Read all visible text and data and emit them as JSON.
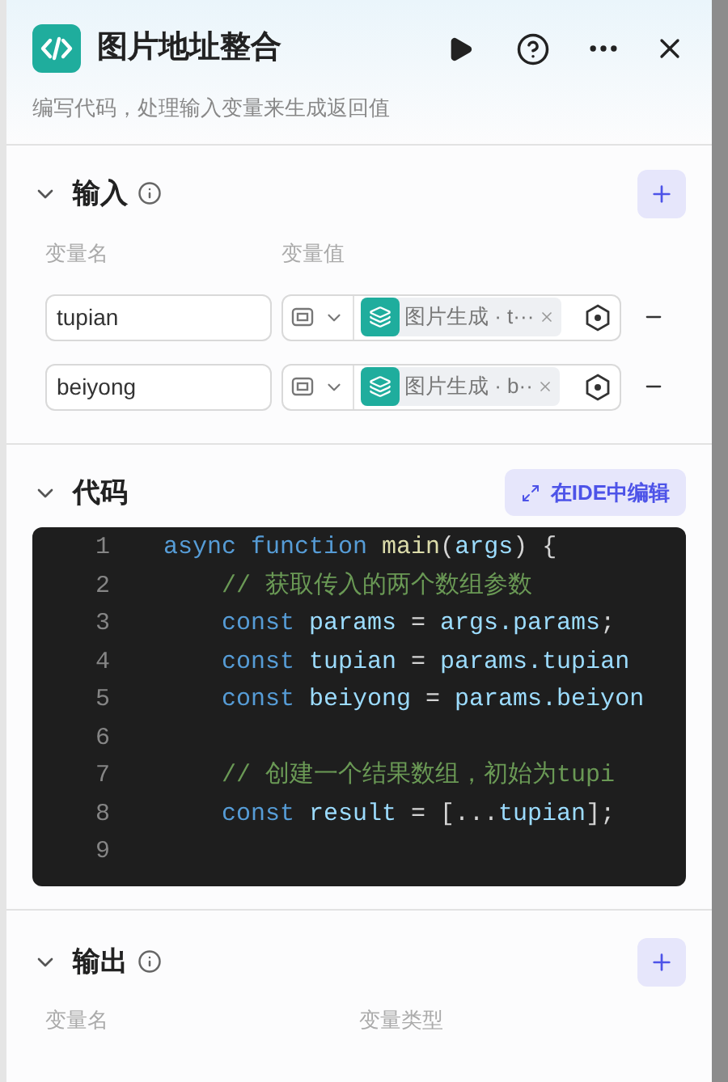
{
  "header": {
    "title": "图片地址整合",
    "description": "编写代码，处理输入变量来生成返回值"
  },
  "input_section": {
    "title": "输入",
    "expanded": true,
    "columns": [
      "变量名",
      "变量值"
    ],
    "rows": [
      {
        "name": "tupian",
        "value": "图片生成 · t···"
      },
      {
        "name": "beiyong",
        "value": "图片生成 · b··"
      }
    ]
  },
  "code_section": {
    "title": "代码",
    "expanded": true,
    "ide_button": "在IDE中编辑",
    "lines": [
      {
        "number": "1",
        "tokens": [
          {
            "text": "async function ",
            "kind": "keyword"
          },
          {
            "text": "main",
            "kind": "function"
          },
          {
            "text": "(",
            "kind": "plain"
          },
          {
            "text": "args",
            "kind": "variable"
          },
          {
            "text": ") {",
            "kind": "plain"
          }
        ]
      },
      {
        "number": "2",
        "tokens": [
          {
            "text": "    // 获取传入的两个数组参数",
            "kind": "comment"
          }
        ]
      },
      {
        "number": "3",
        "tokens": [
          {
            "text": "    const ",
            "kind": "keyword"
          },
          {
            "text": "params",
            "kind": "variable"
          },
          {
            "text": " = ",
            "kind": "plain"
          },
          {
            "text": "args.params",
            "kind": "variable"
          },
          {
            "text": ";",
            "kind": "plain"
          }
        ]
      },
      {
        "number": "4",
        "tokens": [
          {
            "text": "    const ",
            "kind": "keyword"
          },
          {
            "text": "tupian",
            "kind": "variable"
          },
          {
            "text": " = ",
            "kind": "plain"
          },
          {
            "text": "params.tupian",
            "kind": "variable"
          }
        ]
      },
      {
        "number": "5",
        "tokens": [
          {
            "text": "    const ",
            "kind": "keyword"
          },
          {
            "text": "beiyong",
            "kind": "variable"
          },
          {
            "text": " = ",
            "kind": "plain"
          },
          {
            "text": "params.beiyon",
            "kind": "variable"
          }
        ]
      },
      {
        "number": "6"
      },
      {
        "number": "7",
        "tokens": [
          {
            "text": "    // 创建一个结果数组，初始为tupi",
            "kind": "comment"
          }
        ]
      },
      {
        "number": "8",
        "tokens": [
          {
            "text": "    const ",
            "kind": "keyword"
          },
          {
            "text": "result",
            "kind": "variable"
          },
          {
            "text": " = [...",
            "kind": "plain"
          },
          {
            "text": "tupian",
            "kind": "variable"
          },
          {
            "text": "];",
            "kind": "plain"
          }
        ]
      },
      {
        "number": "9"
      }
    ]
  },
  "output_section": {
    "title": "输出",
    "expanded": true,
    "columns": [
      "变量名",
      "变量类型"
    ]
  }
}
